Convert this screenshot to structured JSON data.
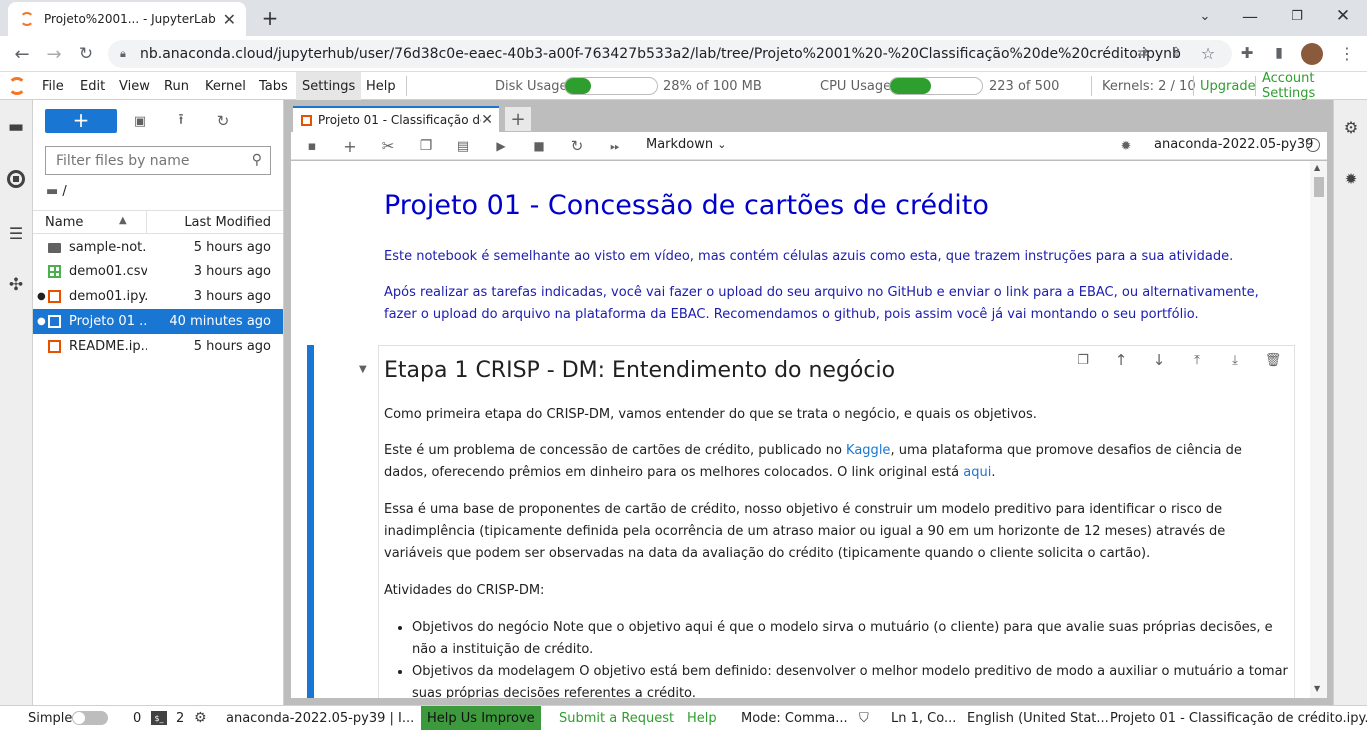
{
  "browser": {
    "tab_title": "Projeto%2001... - JupyterLab",
    "url": "nb.anaconda.cloud/jupyterhub/user/76d38c0e-eaec-40b3-a00f-763427b533a2/lab/tree/Projeto%2001%20-%20Classificação%20de%20crédito.ipynb"
  },
  "menu": {
    "items": [
      "File",
      "Edit",
      "View",
      "Run",
      "Kernel",
      "Tabs",
      "Settings",
      "Help"
    ],
    "active": "Settings",
    "disk_label": "Disk Usage",
    "disk_value": "28% of 100 MB",
    "disk_fraction": 0.28,
    "cpu_label": "CPU Usage",
    "cpu_value": "223 of 500",
    "cpu_fraction": 0.446,
    "kernels": "Kernels: 2 / 10",
    "upgrade": "Upgrade",
    "account": "Account Settings"
  },
  "filebrowser": {
    "new_label": "+",
    "filter_placeholder": "Filter files by name",
    "breadcrumb": "/",
    "col_name": "Name",
    "col_modified": "Last Modified",
    "files": [
      {
        "name": "sample-not...",
        "modified": "5 hours ago",
        "type": "folder"
      },
      {
        "name": "demo01.csv",
        "modified": "3 hours ago",
        "type": "csv"
      },
      {
        "name": "demo01.ipy...",
        "modified": "3 hours ago",
        "type": "notebook"
      },
      {
        "name": "Projeto 01 ...",
        "modified": "40 minutes ago",
        "type": "notebook"
      },
      {
        "name": "README.ip...",
        "modified": "5 hours ago",
        "type": "notebook"
      }
    ]
  },
  "notebook": {
    "tab_title": "Projeto 01 - Classificação de",
    "cell_type": "Markdown",
    "kernel_name": "anaconda-2022.05-py39",
    "title": "Projeto 01 - Concessão de cartões de crédito",
    "intro1": "Este notebook é semelhante ao visto em vídeo, mas contém células azuis como esta, que trazem instruções para a sua atividade.",
    "intro2": "Após realizar as tarefas indicadas, você vai fazer o upload do seu arquivo no GitHub e enviar o link para a EBAC, ou alternativamente, fazer o upload do arquivo na plataforma da EBAC. Recomendamos o github, pois assim você já vai montando o seu portfólio.",
    "section_title": "Etapa 1 CRISP - DM: Entendimento do negócio",
    "p1": "Como primeira etapa do CRISP-DM, vamos entender do que se trata o negócio, e quais os objetivos.",
    "p2_a": "Este é um problema de concessão de cartões de crédito, publicado no ",
    "p2_link1": "Kaggle",
    "p2_b": ", uma plataforma que promove desafios de ciência de dados, oferecendo prêmios em dinheiro para os melhores colocados. O link original está ",
    "p2_link2": "aqui",
    "p2_c": ".",
    "p3": "Essa é uma base de proponentes de cartão de crédito, nosso objetivo é construir um modelo preditivo para identificar o risco de inadimplência (tipicamente definida pela ocorrência de um atraso maior ou igual a 90 em um horizonte de 12 meses) através de variáveis que podem ser observadas na data da avaliação do crédito (tipicamente quando o cliente solicita o cartão).",
    "p4": "Atividades do CRISP-DM:",
    "bullets": [
      "Objetivos do negócio Note que o objetivo aqui é que o modelo sirva o mutuário (o cliente) para que avalie suas próprias decisões, e não a instituição de crédito.",
      "Objetivos da modelagem O objetivo está bem definido: desenvolver o melhor modelo preditivo de modo a auxiliar o mutuário a tomar suas próprias decisões referentes a crédito."
    ]
  },
  "status": {
    "mode_label": "Simple",
    "terminals": "0",
    "kernels": "2",
    "kernel": "anaconda-2022.05-py39 | I...",
    "help_improve": "Help Us Improve",
    "submit": "Submit a Request",
    "help": "Help",
    "mode": "Mode: Comma...",
    "position": "Ln 1, Co...",
    "language": "English (United Stat...",
    "file": "Projeto 01 - Classificação de crédito.ipy..."
  }
}
